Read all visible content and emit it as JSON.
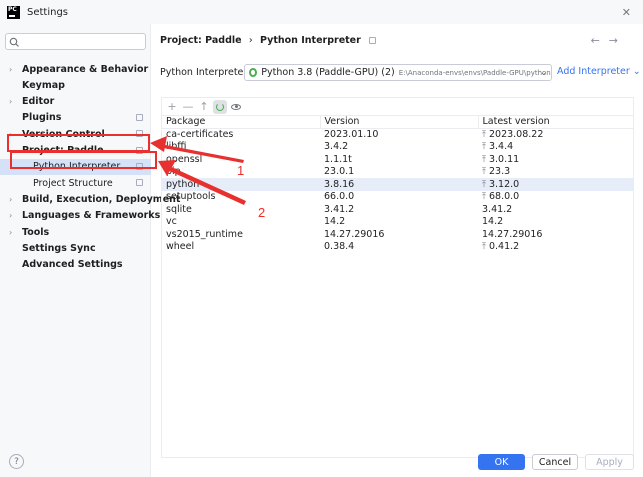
{
  "window": {
    "title": "Settings",
    "logo_text": "PC"
  },
  "search": {
    "placeholder": ""
  },
  "sidebar": {
    "items": [
      {
        "label": "Appearance & Behavior",
        "chevron": "›",
        "shared": false
      },
      {
        "label": "Keymap",
        "chevron": "",
        "shared": false
      },
      {
        "label": "Editor",
        "chevron": "›",
        "shared": false
      },
      {
        "label": "Plugins",
        "chevron": "",
        "shared": true
      },
      {
        "label": "Version Control",
        "chevron": "›",
        "shared": true
      },
      {
        "label": "Project: Paddle",
        "chevron": "⌄",
        "shared": true
      },
      {
        "label": "Python Interpreter",
        "chevron": "",
        "shared": true,
        "selected": true
      },
      {
        "label": "Project Structure",
        "chevron": "",
        "shared": true
      },
      {
        "label": "Build, Execution, Deployment",
        "chevron": "›",
        "shared": false
      },
      {
        "label": "Languages & Frameworks",
        "chevron": "›",
        "shared": false
      },
      {
        "label": "Tools",
        "chevron": "›",
        "shared": false
      },
      {
        "label": "Settings Sync",
        "chevron": "",
        "shared": false
      },
      {
        "label": "Advanced Settings",
        "chevron": "",
        "shared": false
      }
    ]
  },
  "breadcrumb": {
    "project": "Project: Paddle",
    "separator": "›",
    "page": "Python Interpreter"
  },
  "nav": {
    "back": "←",
    "forward": "→"
  },
  "interpreter": {
    "label": "Python Interpreter:",
    "name": "Python 3.8 (Paddle-GPU) (2)",
    "path": "E:\\Anaconda-envs\\envs\\Paddle-GPU\\python.e",
    "add_label": "Add Interpreter",
    "add_chevron": "⌄"
  },
  "toolbar": {
    "add": "+",
    "remove": "—",
    "upgrade": "↑"
  },
  "packages": {
    "columns": [
      "Package",
      "Version",
      "Latest version"
    ],
    "rows": [
      {
        "package": "ca-certificates",
        "version": "2023.01.10",
        "latest": "2023.08.22",
        "upgrade": true
      },
      {
        "package": "libffi",
        "version": "3.4.2",
        "latest": "3.4.4",
        "upgrade": true
      },
      {
        "package": "openssl",
        "version": "1.1.1t",
        "latest": "3.0.11",
        "upgrade": true
      },
      {
        "package": "pip",
        "version": "23.0.1",
        "latest": "23.3",
        "upgrade": true
      },
      {
        "package": "python",
        "version": "3.8.16",
        "latest": "3.12.0",
        "upgrade": true,
        "highlighted": true
      },
      {
        "package": "setuptools",
        "version": "66.0.0",
        "latest": "68.0.0",
        "upgrade": true
      },
      {
        "package": "sqlite",
        "version": "3.41.2",
        "latest": "3.41.2",
        "upgrade": false
      },
      {
        "package": "vc",
        "version": "14.2",
        "latest": "14.2",
        "upgrade": false
      },
      {
        "package": "vs2015_runtime",
        "version": "14.27.29016",
        "latest": "14.27.29016",
        "upgrade": false
      },
      {
        "package": "wheel",
        "version": "0.38.4",
        "latest": "0.41.2",
        "upgrade": true
      }
    ]
  },
  "footer": {
    "help": "?",
    "ok": "OK",
    "cancel": "Cancel",
    "apply": "Apply"
  },
  "annotations": {
    "arrow1_label": "1",
    "arrow2_label": "2",
    "color": "#e8302e"
  },
  "colors": {
    "accent": "#3574f0",
    "selection": "#d5e1f7",
    "annotation": "#e8302e"
  }
}
